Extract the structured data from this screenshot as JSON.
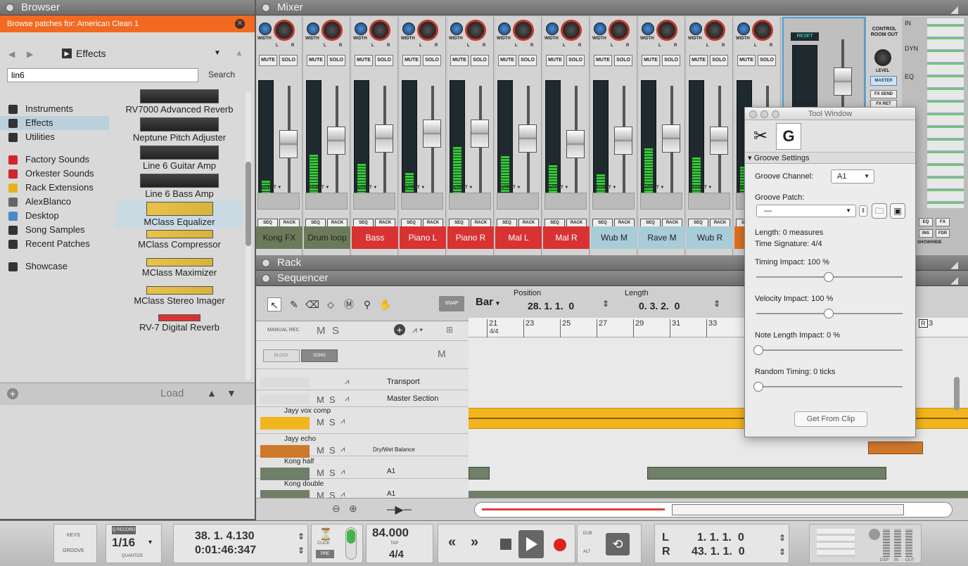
{
  "browser": {
    "title": "Browser",
    "patch_bar": "Browse patches for: American Clean 1",
    "current_folder": "Effects",
    "search_value": "lin6",
    "search_label": "Search",
    "locations": [
      {
        "label": "Instruments",
        "icon": "instruments-icon",
        "color": "#333"
      },
      {
        "label": "Effects",
        "icon": "effects-icon",
        "color": "#333",
        "selected": true
      },
      {
        "label": "Utilities",
        "icon": "utilities-icon",
        "color": "#333"
      },
      {
        "label": "Factory Sounds",
        "icon": "factory-sounds-icon",
        "color": "#d0252d"
      },
      {
        "label": "Orkester Sounds",
        "icon": "orkester-sounds-icon",
        "color": "#d0252d"
      },
      {
        "label": "Rack Extensions",
        "icon": "rack-extensions-icon",
        "color": "#e8b21c"
      },
      {
        "label": "AlexBlanco",
        "icon": "home-icon",
        "color": "#666"
      },
      {
        "label": "Desktop",
        "icon": "desktop-icon",
        "color": "#4a89c8"
      },
      {
        "label": "Song Samples",
        "icon": "song-samples-icon",
        "color": "#333"
      },
      {
        "label": "Recent Patches",
        "icon": "recent-patches-icon",
        "color": "#333"
      },
      {
        "label": "Showcase",
        "icon": "star-icon",
        "color": "#333"
      }
    ],
    "devices": [
      {
        "label": "RV7000 Advanced Reverb"
      },
      {
        "label": "Neptune Pitch Adjuster"
      },
      {
        "label": "Line 6 Guitar Amp"
      },
      {
        "label": "Line 6 Bass Amp"
      },
      {
        "label": "MClass Equalizer",
        "selected": true
      },
      {
        "label": "MClass Compressor"
      },
      {
        "label": "MClass Maximizer"
      },
      {
        "label": "MClass Stereo Imager"
      },
      {
        "label": "RV-7 Digital Reverb"
      }
    ],
    "load_label": "Load"
  },
  "mixer": {
    "title": "Mixer",
    "width_label": "WIDTH",
    "mute_label": "MUTE",
    "solo_label": "SOLO",
    "output_label": "OUTPUT ▼",
    "seq_label": "SEQ",
    "rack_label": "RACK",
    "l_label": "L",
    "r_label": "R",
    "channels": [
      {
        "name": "Kong FX",
        "color": "#6b7b5a",
        "fader": 0.55
      },
      {
        "name": "Drum loop",
        "color": "#6b7b5a",
        "fader": 0.52
      },
      {
        "name": "Bass",
        "color": "#d93232",
        "fader": 0.5
      },
      {
        "name": "Piano L",
        "color": "#d93232",
        "fader": 0.45
      },
      {
        "name": "Piano R",
        "color": "#d93232",
        "fader": 0.45
      },
      {
        "name": "Mal L",
        "color": "#d93232",
        "fader": 0.5
      },
      {
        "name": "Mal R",
        "color": "#d93232",
        "fader": 0.55
      },
      {
        "name": "Wub M",
        "color": "#a8ccd8",
        "fader": 0.52
      },
      {
        "name": "Rave M",
        "color": "#a8ccd8",
        "fader": 0.5
      },
      {
        "name": "Wub R",
        "color": "#a8ccd8",
        "fader": 0.52
      },
      {
        "name": "R",
        "color": "#e07020",
        "fader": 0.5
      }
    ],
    "reset_label": "RESET",
    "control_room": "CONTROL ROOM OUT",
    "level_label": "LEVEL",
    "master_label": "MASTER",
    "fx_send": "FX SEND",
    "fx_ret": "FX RET",
    "right_labels": [
      "IN",
      "DYN",
      "EQ"
    ],
    "bottom_btns": [
      "EQ",
      "FX",
      "INS",
      "FDR"
    ],
    "show_hide": "SHOW/HIDE"
  },
  "rack": {
    "title": "Rack"
  },
  "sequencer": {
    "title": "Sequencer",
    "snap_label": "SNAP",
    "grid_value": "Bar",
    "position_label": "Position",
    "position_value": "28. 1. 1.  0",
    "length_label": "Length",
    "length_value": "0. 3. 2.  0",
    "manual_rec": "MANUAL REC",
    "m_label": "M",
    "s_label": "S",
    "block_label": "BLOCK",
    "song_label": "SONG",
    "ruler": [
      "21",
      "23",
      "25",
      "27",
      "29",
      "31",
      "33"
    ],
    "ruler_sig": "4/4",
    "ruler_r": "R",
    "ruler_r_num": "3",
    "tracks": [
      {
        "name": "Transport"
      },
      {
        "name": "Master Section"
      },
      {
        "name": "Jayy vox comp"
      },
      {
        "name": "Jayy echo",
        "param": "Dry/Wet Balance"
      },
      {
        "name": "Kong half",
        "channel": "A1"
      },
      {
        "name": "Kong double",
        "channel": "A1"
      }
    ]
  },
  "tool_window": {
    "title": "Tool Window",
    "section": "Groove Settings",
    "groove_channel_label": "Groove Channel:",
    "groove_channel_value": "A1",
    "groove_patch_label": "Groove Patch:",
    "groove_patch_value": "—",
    "length_info": "Length: 0 measures",
    "time_sig_info": "Time Signature: 4/4",
    "sliders": [
      {
        "label": "Timing Impact: 100 %",
        "value": 0.5
      },
      {
        "label": "Velocity Impact: 100 %",
        "value": 0.5
      },
      {
        "label": "Note Length Impact: 0 %",
        "value": 0.0
      },
      {
        "label": "Random Timing: 0 ticks",
        "value": 0.0
      }
    ],
    "get_from_clip": "Get From Clip"
  },
  "transport": {
    "keys": "KEYS",
    "groove": "GROOVE",
    "q_record": "Q RECORD",
    "quantize_value": "1/16",
    "quantize_label": "QUANTIZE",
    "bars_pos": "38. 1. 4.130",
    "time_pos": "0:01:46:347",
    "click_label": "CLICK",
    "pre_label": "PRE",
    "tempo": "84.000",
    "tap_label": "TAP",
    "signature": "4/4",
    "dub_label": "DUB",
    "alt_label": "ALT",
    "loop_l_label": "L",
    "loop_r_label": "R",
    "loop_l": "1. 1. 1.  0",
    "loop_r": "43. 1. 1.  0",
    "dsp_label": "DSP",
    "in_label": "IN",
    "out_label": "OUT"
  }
}
